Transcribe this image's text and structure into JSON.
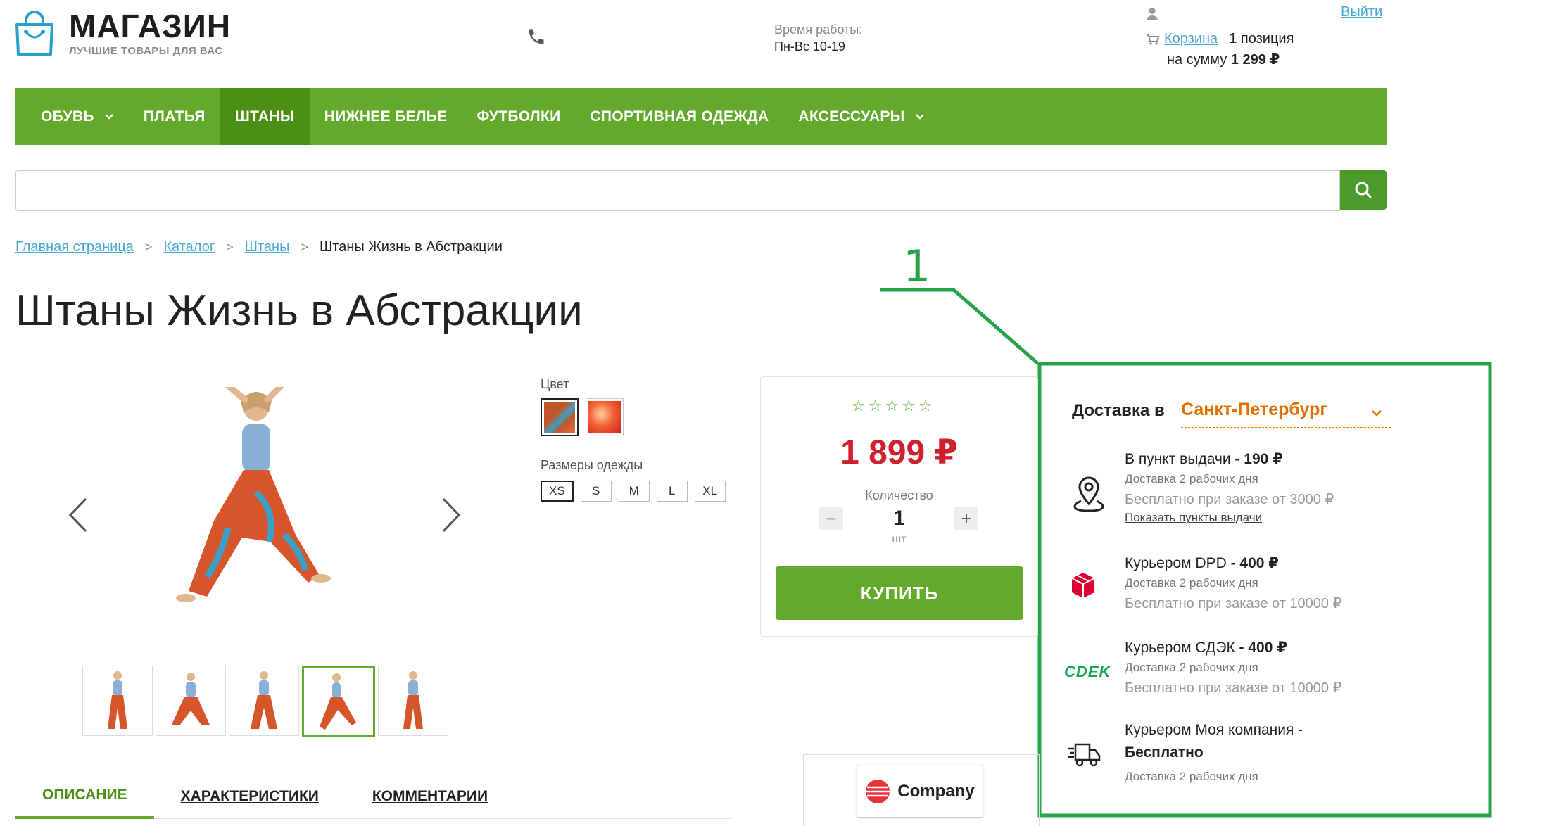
{
  "header": {
    "logo_title": "МАГАЗИН",
    "logo_subtitle": "ЛУЧШИЕ ТОВАРЫ ДЛЯ ВАС",
    "hours_label": "Время работы:",
    "hours_value": "Пн-Вс 10-19",
    "logout": "Выйти",
    "cart_link": "Корзина",
    "cart_count": "1 позиция",
    "cart_sum_label": "на сумму",
    "cart_sum": "1 299 ₽"
  },
  "nav": {
    "items": [
      {
        "label": "ОБУВЬ"
      },
      {
        "label": "ПЛАТЬЯ"
      },
      {
        "label": "ШТАНЫ"
      },
      {
        "label": "НИЖНЕЕ БЕЛЬЕ"
      },
      {
        "label": "ФУТБОЛКИ"
      },
      {
        "label": "СПОРТИВНАЯ ОДЕЖДА"
      },
      {
        "label": "АКСЕССУАРЫ"
      }
    ],
    "active": "ШТАНЫ"
  },
  "search": {
    "placeholder": ""
  },
  "breadcrumbs": {
    "items": [
      "Главная страница",
      "Каталог",
      "Штаны"
    ],
    "current": "Штаны Жизнь в Абстракции"
  },
  "product": {
    "title": "Штаны Жизнь в Абстракции",
    "color_label": "Цвет",
    "sizes_label": "Размеры одежды",
    "sizes": [
      "XS",
      "S",
      "M",
      "L",
      "XL"
    ],
    "selected_size": "XS",
    "rating": 0,
    "price": "1 899 ₽",
    "qty_label": "Количество",
    "qty_minus": "−",
    "qty_plus": "+",
    "qty": "1",
    "qty_unit": "шт",
    "buy": "КУПИТЬ",
    "thumbnails_count": 5,
    "active_thumbnail": 4
  },
  "company": {
    "name": "Company"
  },
  "tabs": [
    "ОПИСАНИЕ",
    "ХАРАКТЕРИСТИКИ",
    "КОММЕНТАРИИ"
  ],
  "delivery": {
    "title": "Доставка в",
    "city": "Санкт-Петербург",
    "options": [
      {
        "name": "В пункт выдачи",
        "price": "- 190 ₽",
        "days": "Доставка 2 рабочих дня",
        "free": "Бесплатно при заказе от 3000 ₽",
        "link": "Показать пункты выдачи"
      },
      {
        "name": "Курьером DPD",
        "price": "- 400 ₽",
        "days": "Доставка 2 рабочих дня",
        "free": "Бесплатно при заказе от 10000 ₽"
      },
      {
        "name": "Курьером СДЭК",
        "price": "- 400 ₽",
        "days": "Доставка 2 рабочих дня",
        "free": "Бесплатно при заказе от 10000 ₽",
        "logo": "CDEK"
      },
      {
        "name": "Курьером Моя компания -",
        "price": "Бесплатно",
        "days": "Доставка 2 рабочих дня"
      }
    ]
  },
  "annotation": {
    "label": "1",
    "color": "#27a348"
  },
  "colors": {
    "accent": "#63aa2c",
    "price": "#d0202f",
    "city": "#e07000",
    "link": "#4aa8d8"
  }
}
